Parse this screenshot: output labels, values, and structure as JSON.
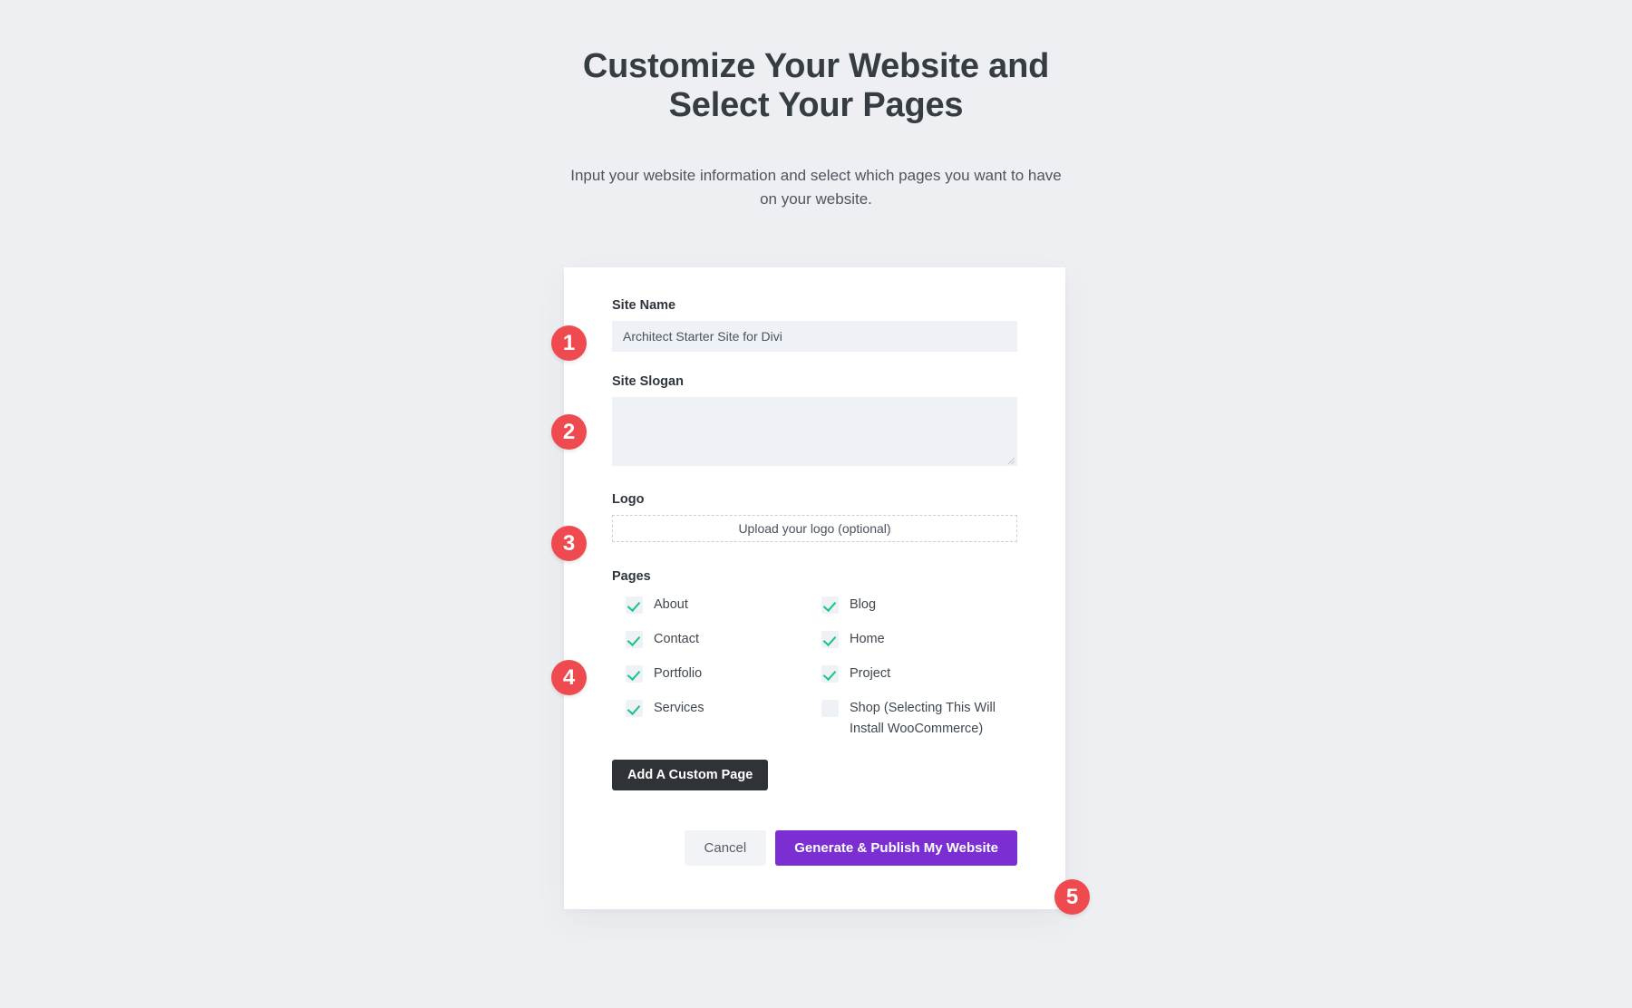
{
  "header": {
    "title": "Customize Your Website and Select Your Pages",
    "subtitle": "Input your website information and select which pages you want to have on your website."
  },
  "form": {
    "site_name": {
      "label": "Site Name",
      "value": "Architect Starter Site for Divi",
      "placeholder": ""
    },
    "site_slogan": {
      "label": "Site Slogan",
      "value": "",
      "placeholder": ""
    },
    "logo": {
      "label": "Logo",
      "upload_text": "Upload your logo (optional)"
    },
    "pages": {
      "label": "Pages",
      "items": [
        {
          "label": "About",
          "checked": true
        },
        {
          "label": "Blog",
          "checked": true
        },
        {
          "label": "Contact",
          "checked": true
        },
        {
          "label": "Home",
          "checked": true
        },
        {
          "label": "Portfolio",
          "checked": true
        },
        {
          "label": "Project",
          "checked": true
        },
        {
          "label": "Services",
          "checked": true
        },
        {
          "label": "Shop (Selecting This Will Install WooCommerce)",
          "checked": false
        }
      ]
    },
    "add_custom_page_label": "Add A Custom Page",
    "cancel_label": "Cancel",
    "generate_label": "Generate & Publish My Website"
  },
  "annotations": {
    "badges": [
      "1",
      "2",
      "3",
      "4",
      "5"
    ]
  },
  "colors": {
    "page_background": "#eeeff2",
    "card_background": "#ffffff",
    "input_background": "#eef1f6",
    "checkmark_green": "#19c48a",
    "primary_purple": "#7b2fd2",
    "dark_button": "#2f3337",
    "badge_red": "#ef4a4f",
    "title_text": "#353c42"
  }
}
